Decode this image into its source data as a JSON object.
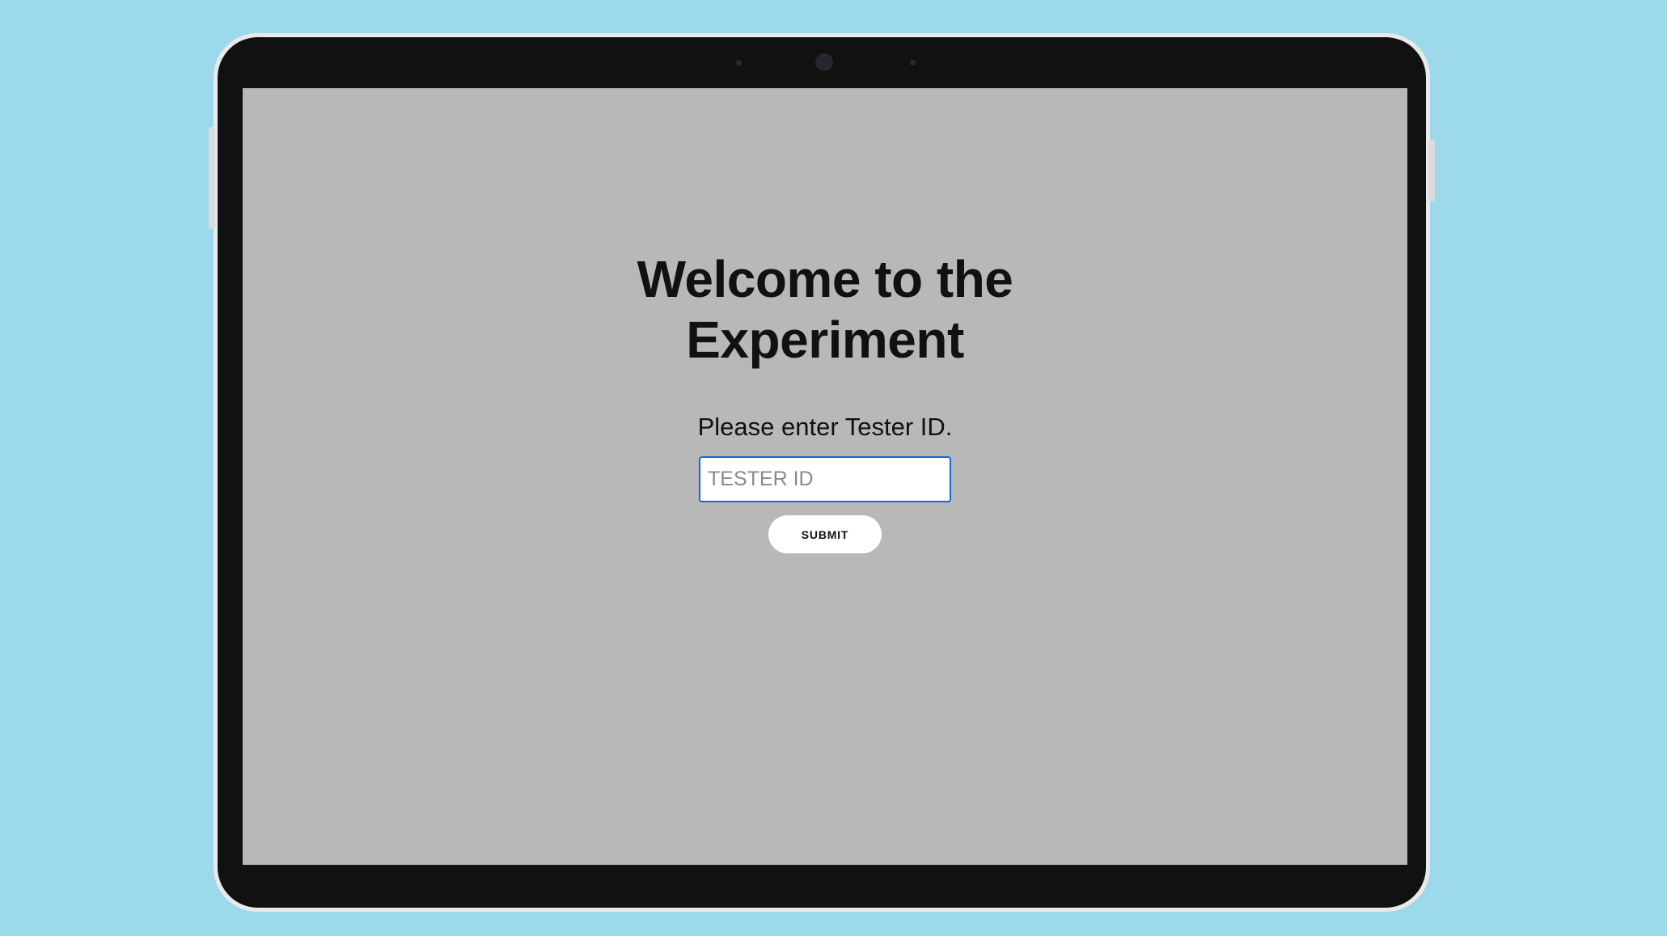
{
  "page": {
    "title": "Welcome to the\nExperiment",
    "title_line1": "Welcome to the",
    "title_line2": "Experiment",
    "prompt": "Please enter Tester ID.",
    "input_placeholder": "TESTER ID",
    "input_value": "",
    "submit_label": "SUBMIT"
  },
  "colors": {
    "desktop_background": "#9cd9ea",
    "device_frame": "#111111",
    "screen_background": "#b8b8b8",
    "input_focus_border": "#1a66cc",
    "button_background": "#ffffff"
  }
}
